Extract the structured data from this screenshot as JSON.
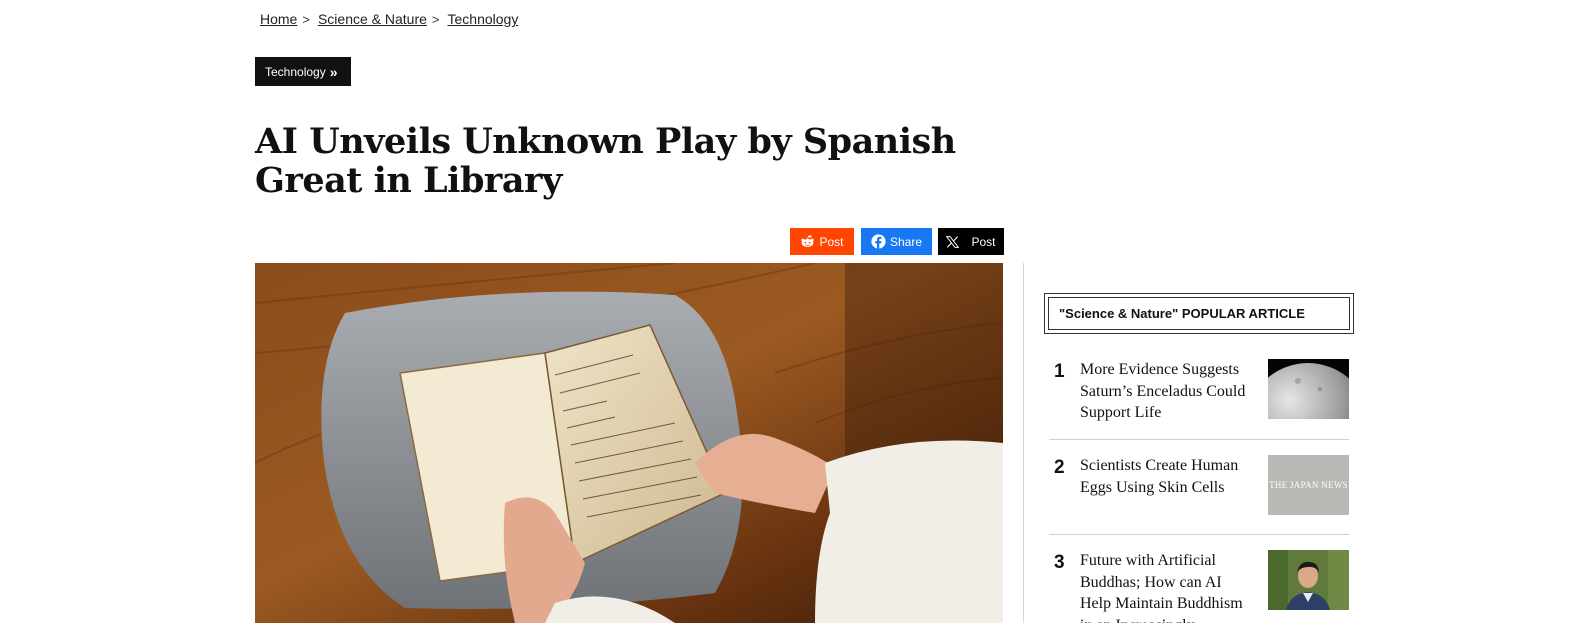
{
  "breadcrumb": {
    "items": [
      "Home",
      "Science & Nature",
      "Technology"
    ],
    "separator": ">"
  },
  "category_tag": {
    "label": "Technology",
    "chevron": "»"
  },
  "article": {
    "title": "AI Unveils Unknown Play by Spanish Great in Library"
  },
  "share": {
    "reddit_label": "Post",
    "facebook_label": "Share",
    "x_label": "Post",
    "colors": {
      "reddit": "#ff4500",
      "facebook": "#1877f2",
      "x": "#000000"
    }
  },
  "hero_image": {
    "icon": "manuscript-photo"
  },
  "popular": {
    "heading": "\"Science & Nature\" POPULAR ARTICLE",
    "items": [
      {
        "rank": "1",
        "title": "More Evidence Suggests Saturn’s Enceladus Could Support Life",
        "thumb": "moon-icon"
      },
      {
        "rank": "2",
        "title": "Scientists Create Human Eggs Using Skin Cells",
        "thumb": "japan-news-logo",
        "logo_text": "THE JAPAN NEWS"
      },
      {
        "rank": "3",
        "title": "Future with Artificial Buddhas; How can AI Help Maintain Buddhism in an Increasingly",
        "thumb": "portrait-photo"
      }
    ]
  }
}
